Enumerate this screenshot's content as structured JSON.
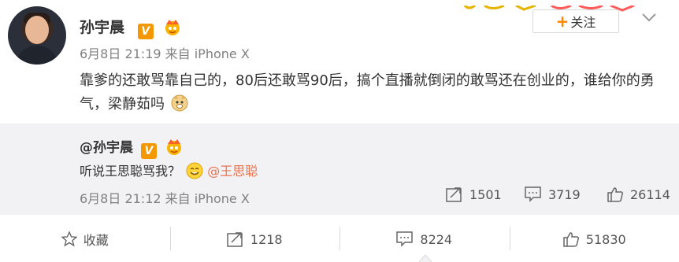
{
  "post": {
    "author": "孙宇晨",
    "verified_badge": "V",
    "time": "6月8日 21:19 来自 iPhone X",
    "text": "靠爹的还敢骂靠自己的，80后还敢骂90后，搞个直播就倒闭的敢骂还在创业的，谁给你的勇气，梁静茹吗",
    "follow_label": "关注",
    "follow_plus": "+"
  },
  "repost": {
    "author": "@孙宇晨",
    "verified_badge": "V",
    "text": "听说王思聪骂我？",
    "mention": "@王思聪",
    "time": "6月8日 21:12 来自 iPhone X",
    "reposts": "1501",
    "comments": "3719",
    "likes": "26114"
  },
  "footer": {
    "favorite_label": "收藏",
    "reposts": "1218",
    "comments": "8224",
    "likes": "51830"
  },
  "colors": {
    "accent_orange": "#ff8200",
    "mention": "#eb7350",
    "repost_bg": "#f2f2f5"
  }
}
